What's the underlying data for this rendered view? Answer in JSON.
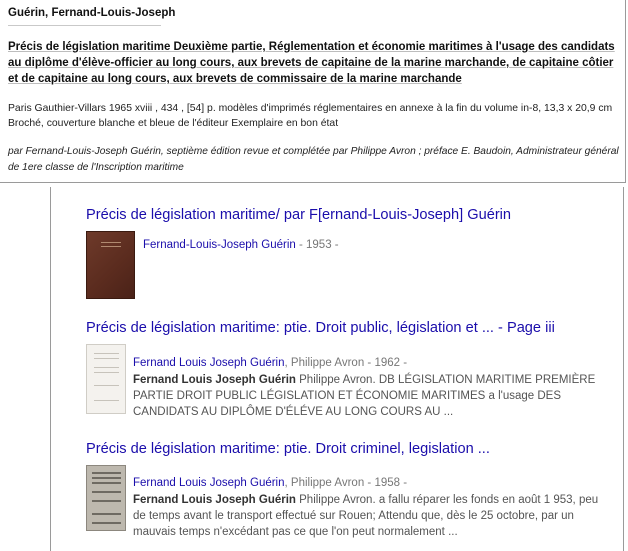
{
  "record": {
    "author": "Guérin, Fernand-Louis-Joseph",
    "title": "Précis de législation maritime Deuxième partie, Réglementation et économie maritimes à l'usage des candidats au diplôme d'élève-officier au long cours, aux brevets de capitaine de la marine marchande, de capitaine côtier et de capitaine au long cours, aux brevets de commissaire de la marine marchande",
    "description": "Paris Gauthier-Villars 1965 xviii , 434 , [54] p. modèles d'imprimés réglementaires en annexe à la fin du volume in-8, 13,3 x 20,9 cm Broché, couverture blanche et bleue de l'éditeur Exemplaire en bon état",
    "note": "par Fernand-Louis-Joseph Guérin, septième édition revue et complétée par Philippe Avron ; préface E. Baudoin, Administrateur général de 1ere classe de l'Inscription maritime"
  },
  "results": [
    {
      "title": "Précis de législation maritime/ par F[ernand-Louis-Joseph] Guérin",
      "author": "Fernand-Louis-Joseph Guérin",
      "meta_rest": " - 1953 -",
      "snippet_bold": "",
      "snippet": ""
    },
    {
      "title": "Précis de législation maritime: ptie. Droit public, législation et ... - Page iii",
      "author": "Fernand Louis Joseph Guérin",
      "meta_rest": ", Philippe Avron - 1962 -",
      "snippet_bold": "Fernand Louis Joseph Guérin",
      "snippet": " Philippe Avron. DB LÉGISLATION MARITIME PREMIÈRE PARTIE DROIT PUBLIC LÉGISLATION ET ÉCONOMIE MARITIMES a l'usage DES CANDIDATS AU DIPLÔME D'ÉLÉVE AU LONG COURS AU ..."
    },
    {
      "title": "Précis de législation maritime: ptie. Droit criminel, legislation ...",
      "author": "Fernand Louis Joseph Guérin",
      "meta_rest": ", Philippe Avron - 1958 -",
      "snippet_bold": "Fernand Louis Joseph Guérin",
      "snippet": " Philippe Avron. a fallu réparer les fonds en août 1 953, peu de temps avant le transport effectué sur Rouen; Attendu que, dès le 25 octobre, par un mauvais temps n'excédant pas ce que l'on peut normalement ..."
    }
  ]
}
